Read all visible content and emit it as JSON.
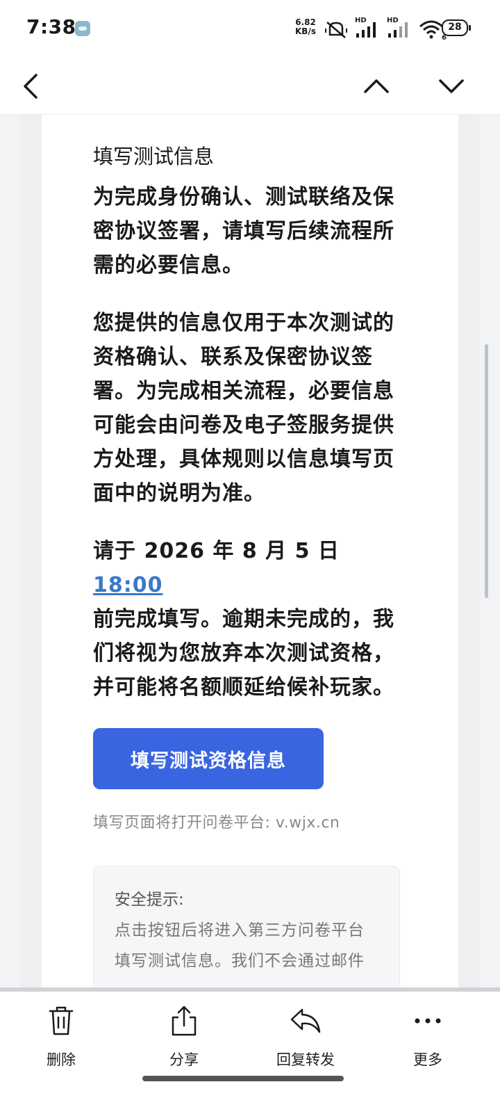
{
  "status": {
    "time": "7:38",
    "net_speed_value": "6.82",
    "net_speed_unit": "KB/s",
    "signal1_label": "HD",
    "signal2_label": "HD",
    "wifi_sub": "6",
    "battery": "28"
  },
  "nav": {
    "back_icon": "chevron-left-icon",
    "prev_icon": "chevron-up-icon",
    "next_icon": "chevron-down-icon"
  },
  "mail": {
    "heading": "填写测试信息",
    "para1": "为完成身份确认、测试联络及保密协议签署，请填写后续流程所需的必要信息。",
    "para2": "您提供的信息仅用于本次测试的资格确认、联系及保密协议签署。为完成相关流程，必要信息可能会由问卷及电子签服务提供方处理，具体规则以信息填写页面中的说明为准。",
    "deadline_prefix": "请于 2026 年 8 月 5 日 ",
    "deadline_time": "18:00",
    "deadline_suffix": "前完成填写。逾期未完成的，我们将视为您放弃本次测试资格，并可能将名额顺延给候补玩家。",
    "cta_label": "填写测试资格信息",
    "platform_note": "填写页面将打开问卷平台: v.wjx.cn",
    "safety_title": "安全提示:",
    "safety_text": "点击按钮后将进入第三方问卷平台填写测试信息。我们不会通过邮件"
  },
  "toolbar": {
    "delete": "删除",
    "share": "分享",
    "reply_forward": "回复转发",
    "more": "更多"
  },
  "colors": {
    "accent": "#3a65e0",
    "link": "#3a78c9"
  }
}
